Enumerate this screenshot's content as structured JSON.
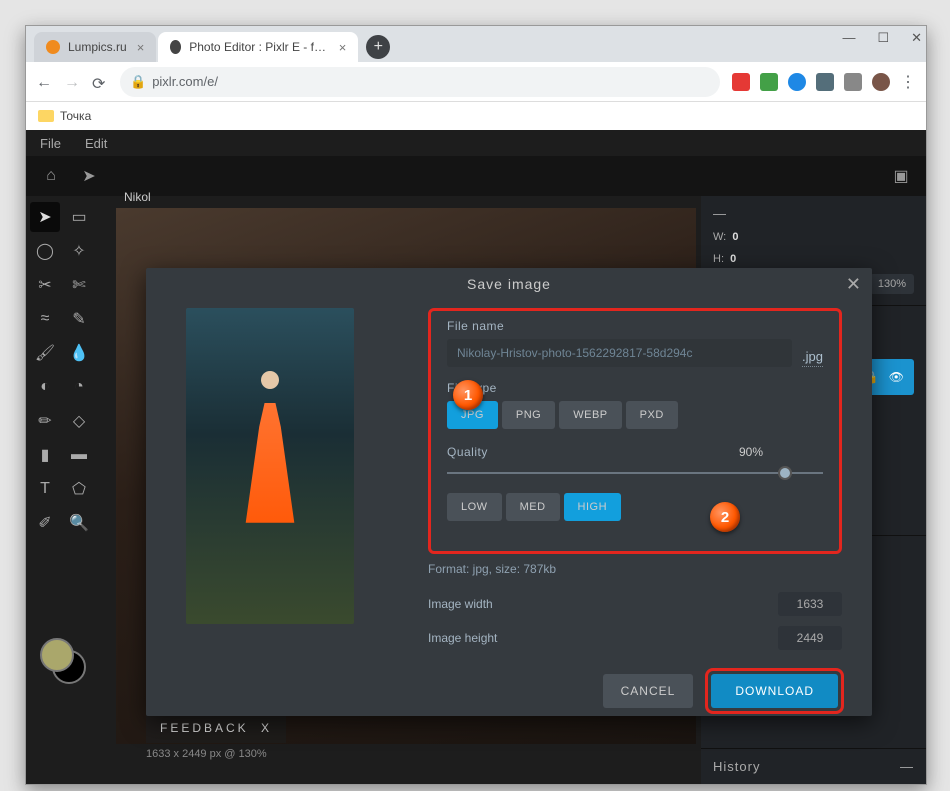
{
  "browser": {
    "tabs": [
      {
        "title": "Lumpics.ru"
      },
      {
        "title": "Photo Editor : Pixlr E - free image"
      }
    ],
    "url": "pixlr.com/e/",
    "bookmark": "Точка"
  },
  "app": {
    "menu": [
      "File",
      "Edit"
    ],
    "doc_tab": "Nikol",
    "feedback": "FEEDBACK",
    "feedback_x": "X",
    "canvas_info": "1633 x 2449 px @ 130%",
    "nav": {
      "w_label": "W:",
      "w": "0",
      "h_label": "H:",
      "h": "0"
    },
    "zoom": "130%",
    "history": "History"
  },
  "dialog": {
    "title": "Save image",
    "file_name_label": "File name",
    "file_name": "Nikolay-Hristov-photo-1562292817-58d294c",
    "ext": ".jpg",
    "file_type_label": "File type",
    "types": [
      "JPG",
      "PNG",
      "WEBP",
      "PXD"
    ],
    "quality_label": "Quality",
    "quality_pct": "90%",
    "qual_levels": [
      "LOW",
      "MED",
      "HIGH"
    ],
    "format_info": "Format: jpg, size: 787kb",
    "width_label": "Image width",
    "width": "1633",
    "height_label": "Image height",
    "height": "2449",
    "cancel": "CANCEL",
    "download": "DOWNLOAD"
  },
  "markers": {
    "one": "1",
    "two": "2"
  }
}
